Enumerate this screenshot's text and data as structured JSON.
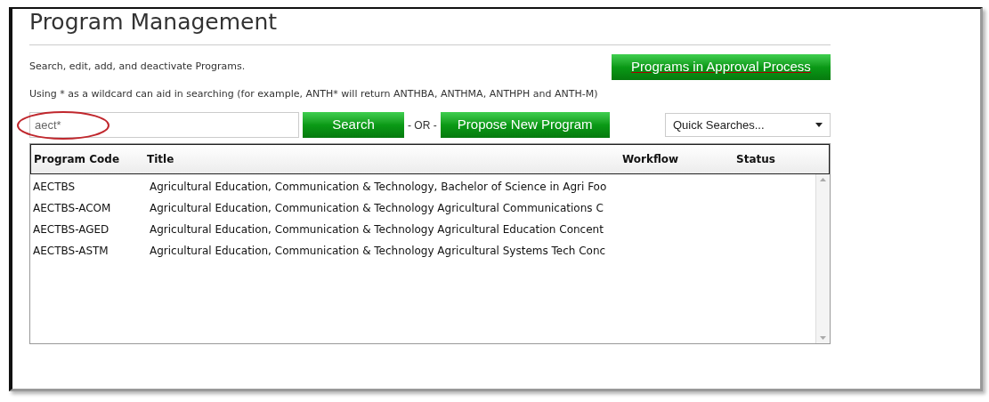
{
  "page": {
    "title": "Program Management",
    "description": "Search, edit, add, and deactivate Programs.",
    "hint": "Using * as a wildcard can aid in searching (for example, ANTH* will return ANTHBA, ANTHMA, ANTHPH and ANTH-M)"
  },
  "approval_button": "Programs in Approval Process",
  "search": {
    "value": "aect*",
    "highlighted": true,
    "button": "Search"
  },
  "separator": "- OR -",
  "propose_button": "Propose New Program",
  "quick_searches": {
    "label": "Quick Searches..."
  },
  "table": {
    "columns": [
      "Program Code",
      "Title",
      "Workflow",
      "Status"
    ],
    "rows": [
      {
        "code": "AECTBS",
        "title": "Agricultural Education, Communication & Technology, Bachelor of Science in Agri Foo"
      },
      {
        "code": "AECTBS-ACOM",
        "title": "Agricultural Education, Communication & Technology Agricultural Communications C"
      },
      {
        "code": "AECTBS-AGED",
        "title": "Agricultural Education, Communication & Technology Agricultural Education Concent"
      },
      {
        "code": "AECTBS-ASTM",
        "title": "Agricultural Education, Communication & Technology Agricultural Systems Tech Conc"
      }
    ]
  }
}
